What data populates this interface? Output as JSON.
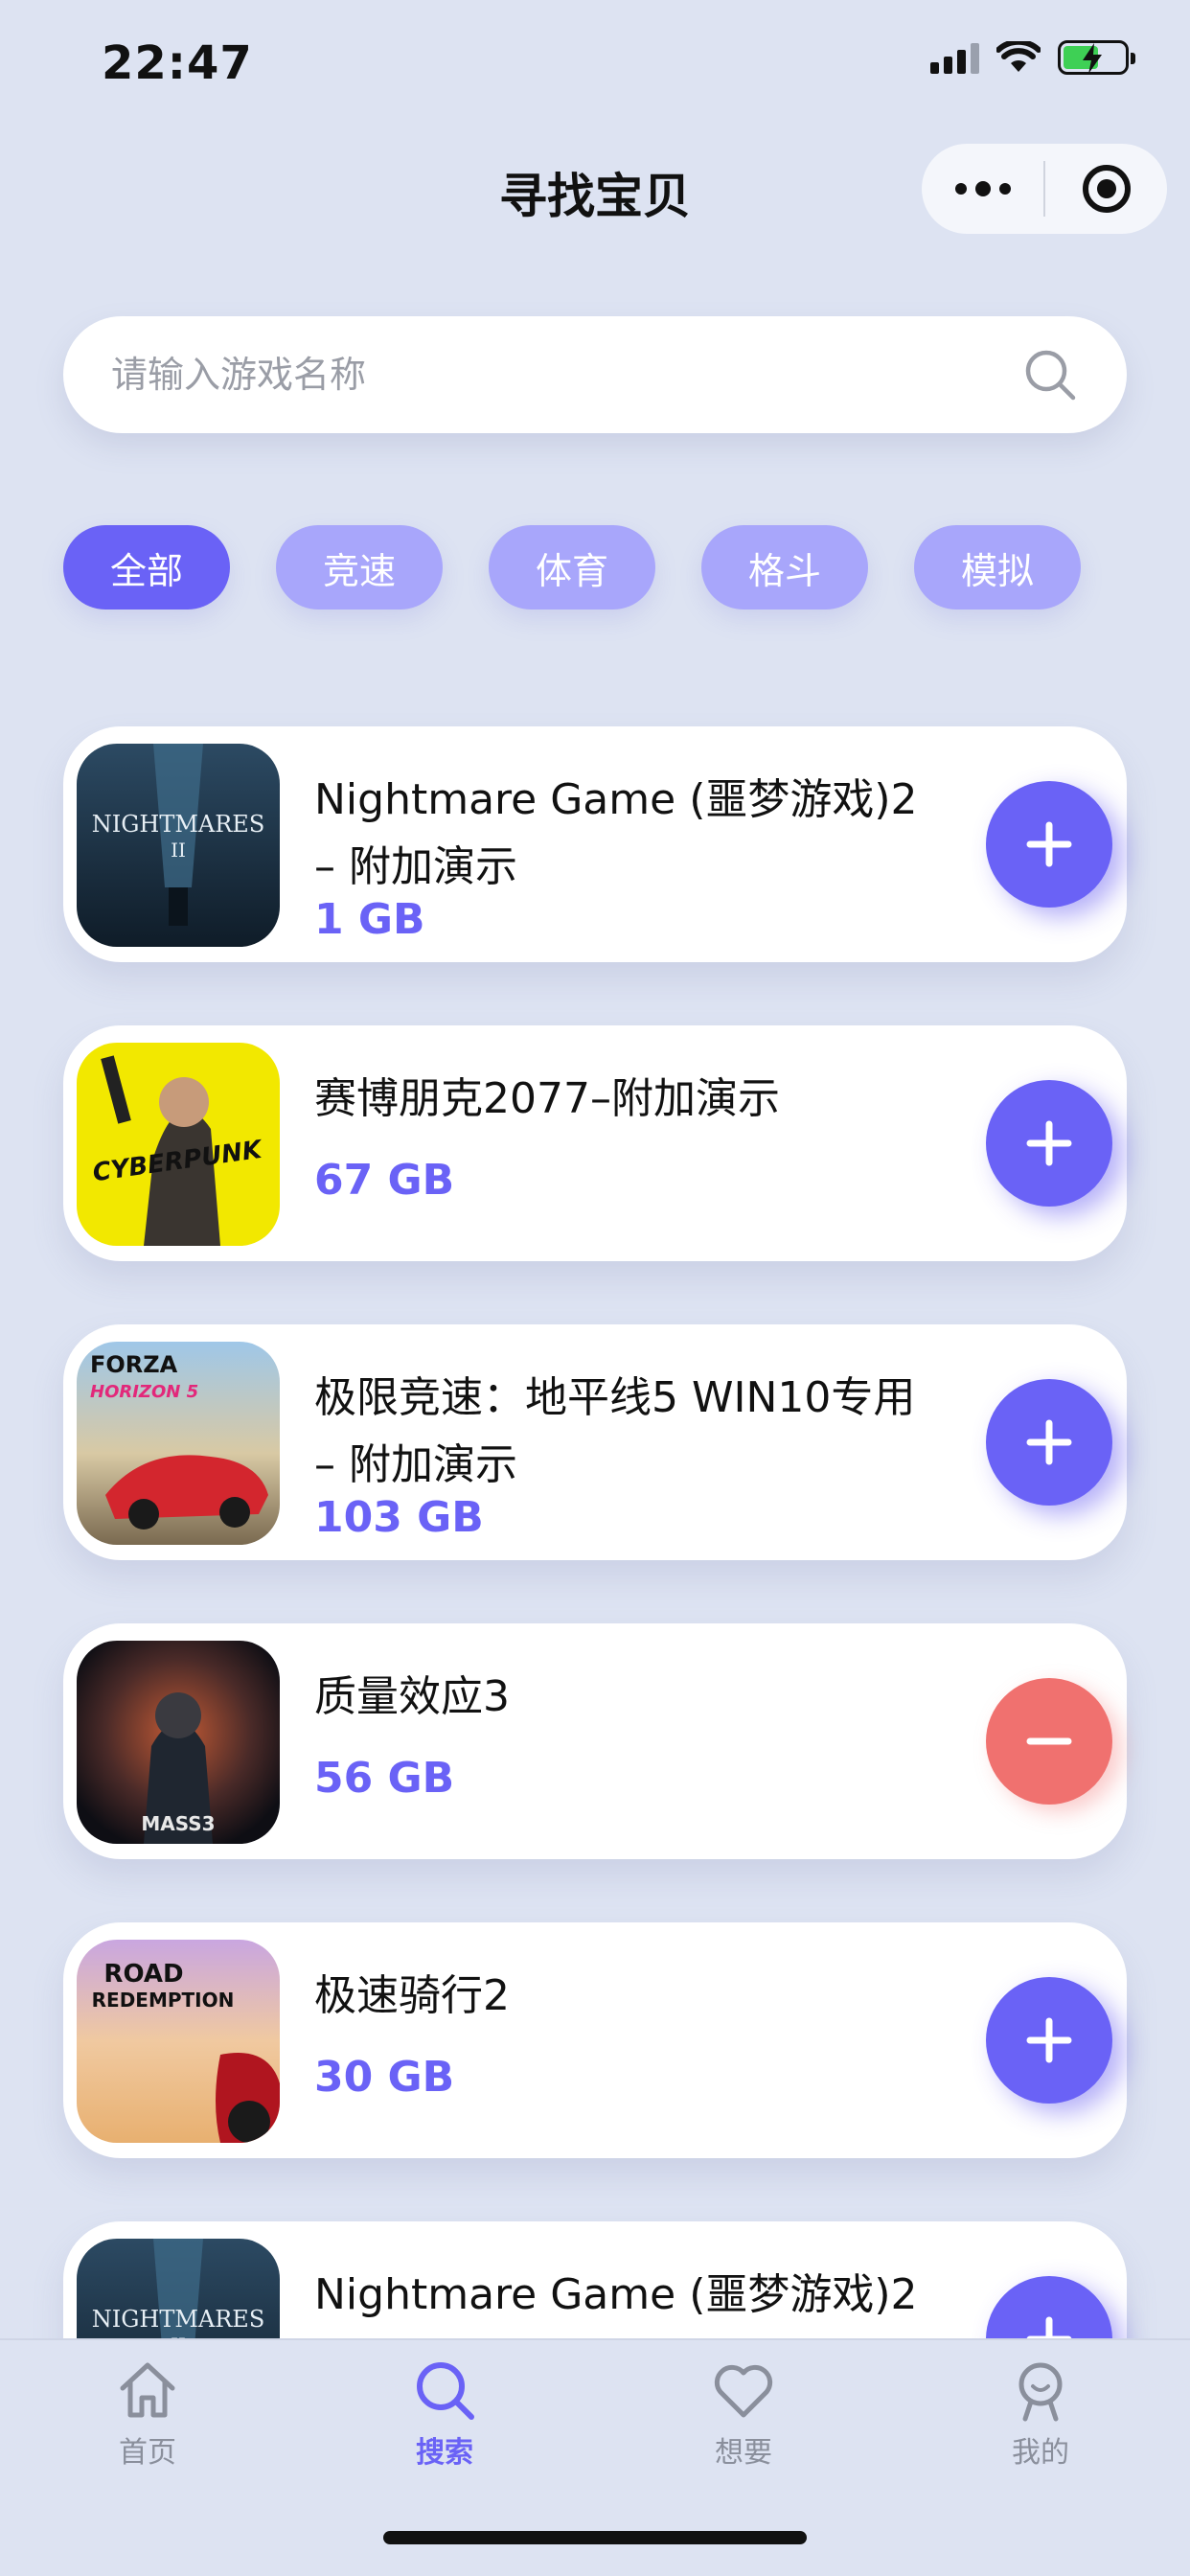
{
  "status_bar": {
    "time": "22:47"
  },
  "nav": {
    "title": "寻找宝贝"
  },
  "search": {
    "placeholder": "请输入游戏名称"
  },
  "categories": [
    {
      "label": "全部",
      "active": true
    },
    {
      "label": "竞速",
      "active": false
    },
    {
      "label": "体育",
      "active": false
    },
    {
      "label": "格斗",
      "active": false
    },
    {
      "label": "模拟",
      "active": false
    }
  ],
  "games": [
    {
      "name_line1": "Nightmare Game (噩梦游戏)2",
      "name_line2": "– 附加演示",
      "size": "1 GB",
      "action": "add"
    },
    {
      "name_line1": "赛博朋克2077–附加演示",
      "name_line2": "",
      "size": "67 GB",
      "action": "add",
      "cover_text": "CYBERPUNK"
    },
    {
      "name_line1": "极限竞速：地平线5 WIN10专用",
      "name_line2": "– 附加演示",
      "size": "103 GB",
      "action": "add",
      "cover_text_1": "FORZA",
      "cover_text_2": "HORIZON 5"
    },
    {
      "name_line1": "质量效应3",
      "name_line2": "",
      "size": "56 GB",
      "action": "remove",
      "cover_text": "MASS3"
    },
    {
      "name_line1": "极速骑行2",
      "name_line2": "",
      "size": "30 GB",
      "action": "add",
      "cover_text_1": "ROAD",
      "cover_text_2": "REDEMPTION"
    },
    {
      "name_line1": "Nightmare Game (噩梦游戏)2",
      "name_line2": "",
      "size": "",
      "action": "add"
    }
  ],
  "covers": {
    "nightmares_title": "NIGHTMARES"
  },
  "tabbar": [
    {
      "label": "首页",
      "icon": "home-icon",
      "active": false
    },
    {
      "label": "搜索",
      "icon": "search-icon",
      "active": true
    },
    {
      "label": "想要",
      "icon": "heart-icon",
      "active": false
    },
    {
      "label": "我的",
      "icon": "profile-icon",
      "active": false
    }
  ],
  "colors": {
    "accent": "#6a62f6",
    "chip": "#a8a6fb",
    "remove": "#f0716f",
    "background": "#dde3f2"
  }
}
